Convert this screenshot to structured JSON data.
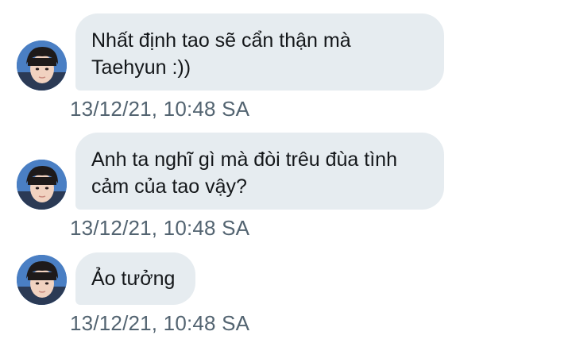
{
  "colors": {
    "bubble_bg": "#e6ecf0",
    "message_text": "#14171a",
    "timestamp_text": "#536471",
    "background": "#ffffff"
  },
  "messages": [
    {
      "avatar_icon": "profile-photo-icon",
      "text_line1": "Nhất định tao sẽ cẩn thận mà",
      "text_line2": "Taehyun :))",
      "timestamp": "13/12/21, 10:48 SA"
    },
    {
      "avatar_icon": "profile-photo-icon",
      "text_line1": "Anh ta nghĩ gì mà đòi trêu đùa tình",
      "text_line2": "cảm của tao vậy?",
      "timestamp": "13/12/21, 10:48 SA"
    },
    {
      "avatar_icon": "profile-photo-icon",
      "text_line1": "Ảo tưởng",
      "timestamp": "13/12/21, 10:48 SA"
    }
  ]
}
